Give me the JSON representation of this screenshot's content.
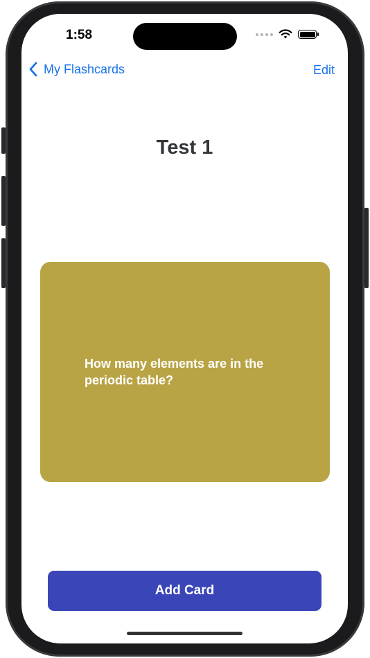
{
  "status_bar": {
    "time": "1:58"
  },
  "nav": {
    "back_label": "My Flashcards",
    "edit_label": "Edit"
  },
  "deck": {
    "title": "Test 1"
  },
  "card": {
    "question": "How many elements are in the periodic table?",
    "color": "#b8a444"
  },
  "actions": {
    "add_card_label": "Add Card"
  },
  "colors": {
    "accent": "#1a73e8",
    "button": "#3a45b8",
    "title": "#333638"
  },
  "icons": [
    "chevron-left-icon",
    "wifi-icon",
    "battery-icon",
    "signal-dots-icon"
  ]
}
